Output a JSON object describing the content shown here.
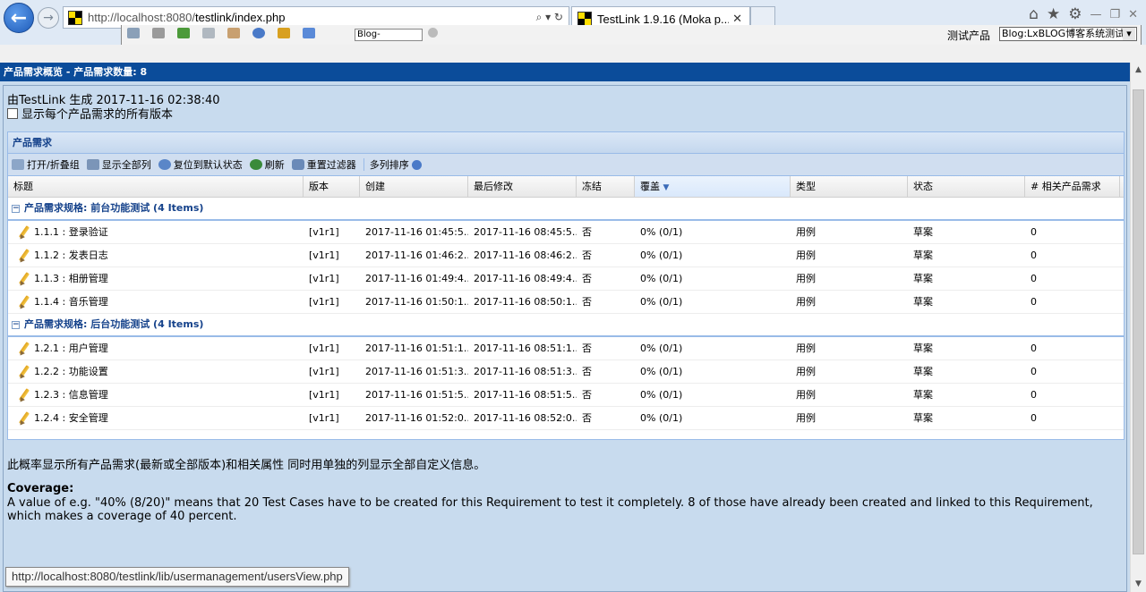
{
  "browser": {
    "url_prefix": "http://localhost:8080/",
    "url_rest": "testlink/index.php",
    "tab_title": "TestLink 1.9.16 (Moka p...",
    "tab_close": "✕",
    "back_glyph": "←",
    "forward_glyph": "→",
    "addr_controls": "⌕ ▾ ↻",
    "home_icon": "⌂",
    "star_icon": "★",
    "gear_icon": "⚙",
    "minimize": "—",
    "restore": "❐",
    "close": "✕"
  },
  "top_strip": {
    "search_value": "Blog-",
    "project_label": "测试产品",
    "project_selected": "Blog:LxBLOG博客系统测试"
  },
  "page": {
    "header": "产品需求概览 - 产品需求数量: 8",
    "generated_by": "由TestLink 生成 2017-11-16 02:38:40",
    "show_all_versions": "显示每个产品需求的所有版本"
  },
  "panel": {
    "title": "产品需求",
    "toolbar": {
      "expand_collapse": "打开/折叠组",
      "show_all_cols": "显示全部列",
      "reset_default": "复位到默认状态",
      "refresh": "刷新",
      "reset_filters": "重置过滤器",
      "multi_sort": "多列排序"
    },
    "columns": [
      "标题",
      "版本",
      "创建",
      "最后修改",
      "冻结",
      "覆盖",
      "类型",
      "状态",
      "# 相关产品需求"
    ],
    "groups": [
      {
        "label": "产品需求规格: 前台功能测试 (4 Items)",
        "toggle": "−",
        "rows": [
          {
            "title": "1.1.1 : 登录验证",
            "version": "[v1r1]",
            "created": "2017-11-16 01:45:5...",
            "modified": "2017-11-16 08:45:5...",
            "frozen": "否",
            "coverage": "0% (0/1)",
            "type": "用例",
            "status": "草案",
            "related": "0"
          },
          {
            "title": "1.1.2 : 发表日志",
            "version": "[v1r1]",
            "created": "2017-11-16 01:46:2...",
            "modified": "2017-11-16 08:46:2...",
            "frozen": "否",
            "coverage": "0% (0/1)",
            "type": "用例",
            "status": "草案",
            "related": "0"
          },
          {
            "title": "1.1.3 : 相册管理",
            "version": "[v1r1]",
            "created": "2017-11-16 01:49:4...",
            "modified": "2017-11-16 08:49:4...",
            "frozen": "否",
            "coverage": "0% (0/1)",
            "type": "用例",
            "status": "草案",
            "related": "0"
          },
          {
            "title": "1.1.4 : 音乐管理",
            "version": "[v1r1]",
            "created": "2017-11-16 01:50:1...",
            "modified": "2017-11-16 08:50:1...",
            "frozen": "否",
            "coverage": "0% (0/1)",
            "type": "用例",
            "status": "草案",
            "related": "0"
          }
        ]
      },
      {
        "label": "产品需求规格: 后台功能测试 (4 Items)",
        "toggle": "−",
        "rows": [
          {
            "title": "1.2.1 : 用户管理",
            "version": "[v1r1]",
            "created": "2017-11-16 01:51:1...",
            "modified": "2017-11-16 08:51:1...",
            "frozen": "否",
            "coverage": "0% (0/1)",
            "type": "用例",
            "status": "草案",
            "related": "0"
          },
          {
            "title": "1.2.2 : 功能设置",
            "version": "[v1r1]",
            "created": "2017-11-16 01:51:3...",
            "modified": "2017-11-16 08:51:3...",
            "frozen": "否",
            "coverage": "0% (0/1)",
            "type": "用例",
            "status": "草案",
            "related": "0"
          },
          {
            "title": "1.2.3 : 信息管理",
            "version": "[v1r1]",
            "created": "2017-11-16 01:51:5...",
            "modified": "2017-11-16 08:51:5...",
            "frozen": "否",
            "coverage": "0% (0/1)",
            "type": "用例",
            "status": "草案",
            "related": "0"
          },
          {
            "title": "1.2.4 : 安全管理",
            "version": "[v1r1]",
            "created": "2017-11-16 01:52:0...",
            "modified": "2017-11-16 08:52:0...",
            "frozen": "否",
            "coverage": "0% (0/1)",
            "type": "用例",
            "status": "草案",
            "related": "0"
          }
        ]
      }
    ]
  },
  "description": "此概率显示所有产品需求(最新或全部版本)和相关属性 同时用单独的列显示全部自定义信息。",
  "coverage": {
    "title": "Coverage:",
    "text": "A value of e.g. \"40% (8/20)\" means that 20 Test Cases have to be created for this Requirement to test it completely. 8 of those have already been created and linked to this Requirement, which makes a coverage of 40 percent."
  },
  "status_bar_url": "http://localhost:8080/testlink/lib/usermanagement/usersView.php",
  "scrollbar": {
    "up": "▲",
    "down": "▼"
  },
  "colors": {
    "header_blue": "#0b4c9a",
    "page_bg": "#c8dbee",
    "grid_border": "#99bbe8"
  }
}
